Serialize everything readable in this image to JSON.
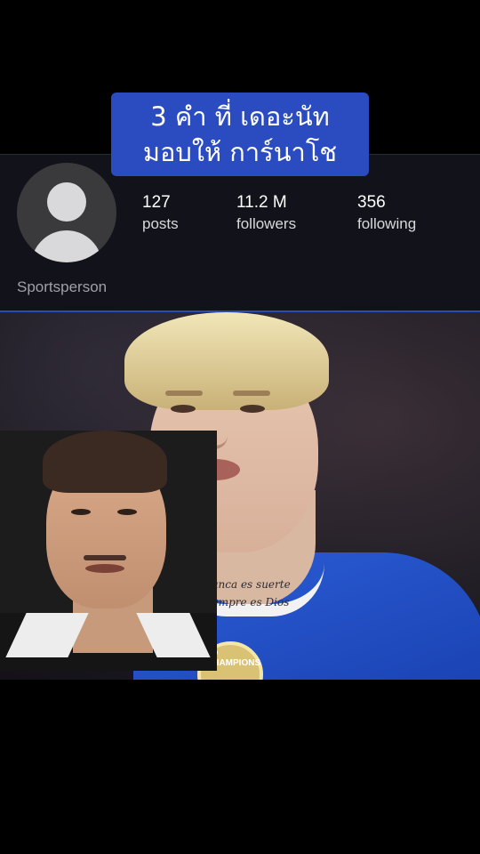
{
  "title_overlay": {
    "line1": "3 คำ ที่ เดอะนัท",
    "line2": "มอบให้ การ์นาโช"
  },
  "profile": {
    "username": "Sportsperson",
    "stats": {
      "posts_count": "127",
      "posts_label": "posts",
      "followers_count": "11.2 M",
      "followers_label": "followers",
      "following_count": "356",
      "following_label": "following"
    }
  },
  "photo": {
    "tattoo_line1": "Nunca es suerte",
    "tattoo_line2": "siempre es Dios",
    "badge_text": "LD CHAMPIONS"
  },
  "colors": {
    "title_bg": "#2b4bc0",
    "card_bg": "#12121a",
    "shirt_blue": "#2c5dd6"
  }
}
